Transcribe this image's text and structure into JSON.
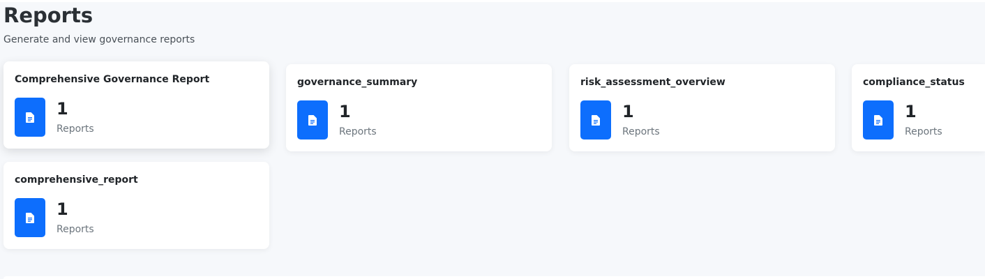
{
  "header": {
    "title": "Reports",
    "subtitle": "Generate and view governance reports"
  },
  "cards": [
    {
      "title": "Comprehensive Governance Report",
      "count": "1",
      "unit": "Reports",
      "icon": "document-icon",
      "icon_color": "#0d6efd"
    },
    {
      "title": "governance_summary",
      "count": "1",
      "unit": "Reports",
      "icon": "document-icon",
      "icon_color": "#0d6efd"
    },
    {
      "title": "risk_assessment_overview",
      "count": "1",
      "unit": "Reports",
      "icon": "document-icon",
      "icon_color": "#0d6efd"
    },
    {
      "title": "compliance_status",
      "count": "1",
      "unit": "Reports",
      "icon": "document-icon",
      "icon_color": "#0d6efd"
    },
    {
      "title": "comprehensive_report",
      "count": "1",
      "unit": "Reports",
      "icon": "document-icon",
      "icon_color": "#0d6efd"
    }
  ],
  "colors": {
    "background": "#f6f8fb",
    "card": "#ffffff",
    "accent": "#0d6efd"
  }
}
